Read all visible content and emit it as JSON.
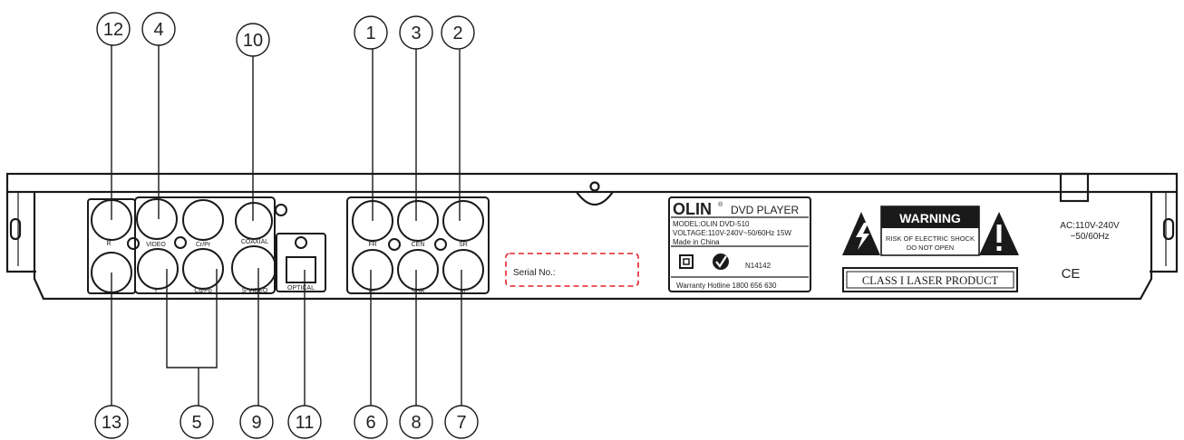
{
  "callouts": {
    "n1": "1",
    "n2": "2",
    "n3": "3",
    "n4": "4",
    "n5": "5",
    "n6": "6",
    "n7": "7",
    "n8": "8",
    "n9": "9",
    "n10": "10",
    "n11": "11",
    "n12": "12",
    "n13": "13"
  },
  "jacks": {
    "r": "R",
    "video": "VIDEO",
    "y": "Y",
    "cr_pr": "Cr/Pr",
    "cb_pb": "Cb/Pb",
    "coaxial": "COAXIAL",
    "s_video": "S-VIDEO",
    "optical": "OPTICAL",
    "fr": "FR",
    "cen": "CEN",
    "sr": "SR",
    "fl": "FL",
    "sub": "SUB",
    "sl": "SL"
  },
  "serial": {
    "label": "Serial No.:"
  },
  "rating_plate": {
    "brand": "OLIN",
    "brand_mark": "®",
    "product": "DVD PLAYER",
    "model": "MODEL:OLIN DVD-510",
    "voltage": "VOLTAGE:110V-240V~50/60Hz 15W",
    "origin": "Made in China",
    "code": "N14142",
    "hotline": "Warranty Hotline 1800 656 630"
  },
  "warning": {
    "title": "WARNING",
    "line1": "RISK OF ELECTRIC SHOCK",
    "line2": "DO NOT OPEN",
    "laser": "CLASS I LASER PRODUCT"
  },
  "power": {
    "line1": "AC:110V-240V",
    "line2": "~50/60Hz",
    "ce": "CE"
  }
}
